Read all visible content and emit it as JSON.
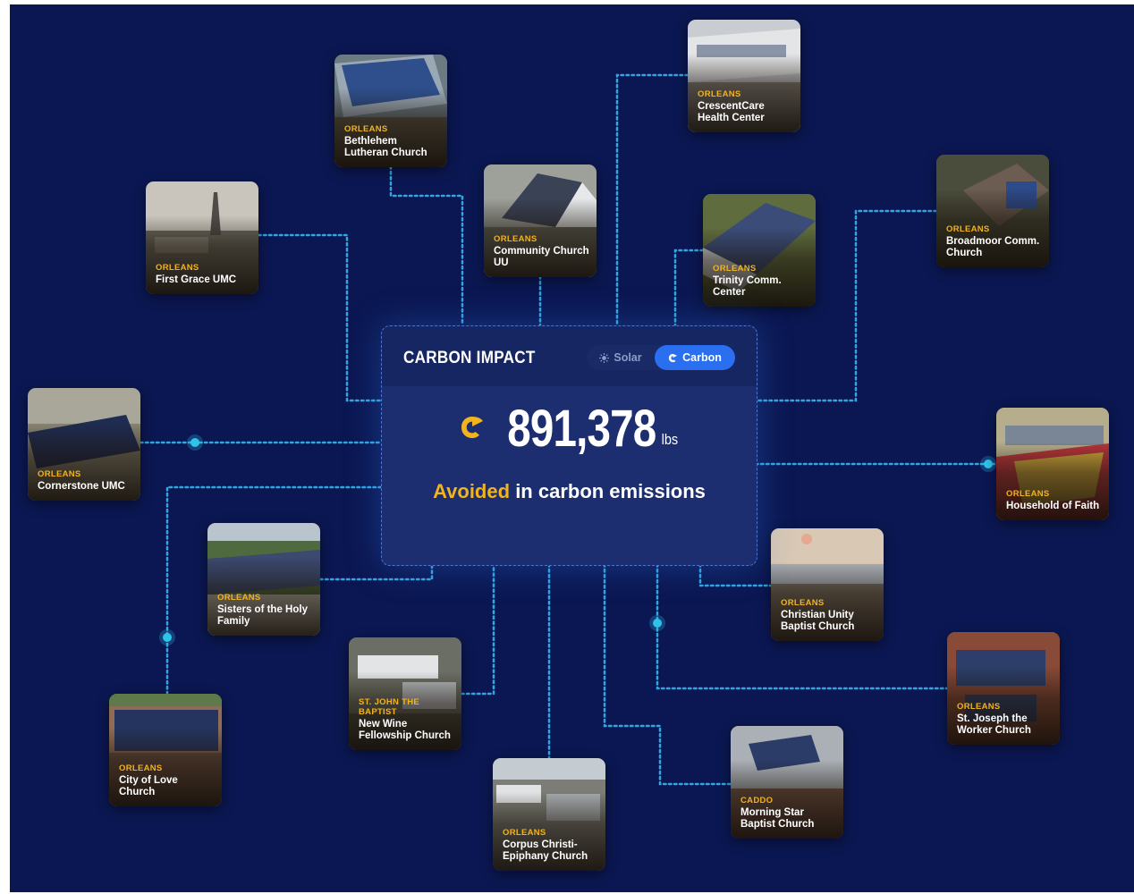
{
  "panel": {
    "title": "CARBON IMPACT",
    "toggle": {
      "solar_label": "Solar",
      "carbon_label": "Carbon",
      "active": "Carbon"
    },
    "stat_value": "891,378",
    "stat_unit": "lbs",
    "caption_highlight": "Avoided",
    "caption_rest": "in carbon emissions"
  },
  "colors": {
    "background": "#0b1752",
    "panel": "#1c2e70",
    "accent_blue": "#2a6ff0",
    "connector": "#35b6f0",
    "highlight": "#f2b31d"
  },
  "sites": [
    {
      "parish": "ORLEANS",
      "name": "Bethlehem Lutheran Church"
    },
    {
      "parish": "ORLEANS",
      "name": "CrescentCare Health Center"
    },
    {
      "parish": "ORLEANS",
      "name": "First Grace UMC"
    },
    {
      "parish": "ORLEANS",
      "name": "Community Church UU"
    },
    {
      "parish": "ORLEANS",
      "name": "Trinity Comm. Center"
    },
    {
      "parish": "ORLEANS",
      "name": "Broadmoor Comm. Church"
    },
    {
      "parish": "ORLEANS",
      "name": "Cornerstone UMC"
    },
    {
      "parish": "ORLEANS",
      "name": "Household of Faith"
    },
    {
      "parish": "ORLEANS",
      "name": "Sisters of the Holy Family"
    },
    {
      "parish": "ORLEANS",
      "name": "Christian Unity Baptist Church"
    },
    {
      "parish": "ST. JOHN THE BAPTIST",
      "name": "New Wine Fellowship Church"
    },
    {
      "parish": "ORLEANS",
      "name": "St. Joseph the Worker Church"
    },
    {
      "parish": "ORLEANS",
      "name": "City of Love Church"
    },
    {
      "parish": "CADDO",
      "name": "Morning Star Baptist Church"
    },
    {
      "parish": "ORLEANS",
      "name": "Corpus Christi-Epiphany Church"
    }
  ]
}
